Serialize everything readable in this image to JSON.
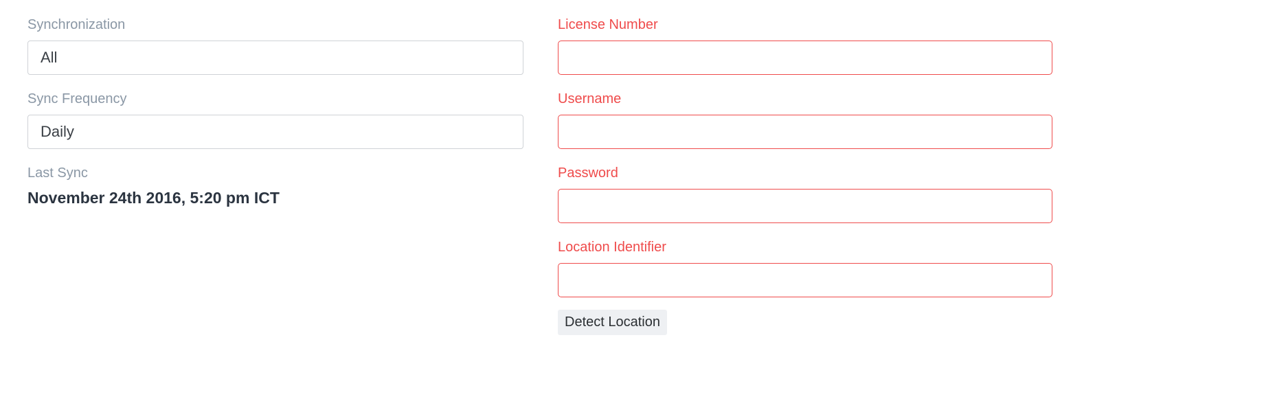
{
  "sync": {
    "synchronization_label": "Synchronization",
    "synchronization_value": "All",
    "frequency_label": "Sync Frequency",
    "frequency_value": "Daily",
    "last_sync_label": "Last Sync",
    "last_sync_value": "November 24th 2016, 5:20 pm ICT"
  },
  "credentials": {
    "license_label": "License Number",
    "license_value": "",
    "username_label": "Username",
    "username_value": "",
    "password_label": "Password",
    "password_value": "",
    "location_label": "Location Identifier",
    "location_value": "",
    "detect_button_label": "Detect Location"
  },
  "colors": {
    "error": "#ef4b4b",
    "muted_label": "#8a97a5",
    "value_text": "#2b3440",
    "button_bg": "#eef0f3"
  }
}
